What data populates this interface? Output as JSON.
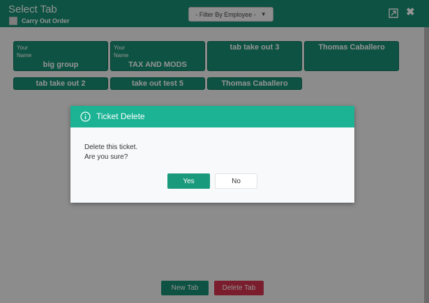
{
  "header": {
    "title": "Select Tab",
    "carry_out_label": "Carry Out Order",
    "filter_label": "- Filter By Employee -",
    "colors": {
      "header_bg": "#178e72"
    },
    "icons": {
      "expand": "expand-icon",
      "close": "close-icon",
      "dropdown": "chevron-down-icon"
    }
  },
  "tabs": [
    {
      "top_line1": "Your",
      "top_line2": "Name",
      "main": "big group"
    },
    {
      "top_line1": "Your",
      "top_line2": "Name",
      "main": "TAX AND MODS"
    },
    {
      "main": "tab take out 3"
    },
    {
      "main": "Thomas Caballero"
    },
    {
      "main": "tab take out 2"
    },
    {
      "main": "take out test 5"
    },
    {
      "main": "Thomas Caballero"
    }
  ],
  "actions": {
    "new_tab": "New Tab",
    "delete_tab": "Delete Tab",
    "colors": {
      "new": "#178e72",
      "delete": "#d2334d"
    }
  },
  "dialog": {
    "title": "Ticket Delete",
    "message_line1": "Delete this ticket.",
    "message_line2": "Are you sure?",
    "yes_label": "Yes",
    "no_label": "No",
    "icon": "info-icon",
    "colors": {
      "header_bg": "#1bb394",
      "yes_bg": "#1a9a7c"
    }
  }
}
